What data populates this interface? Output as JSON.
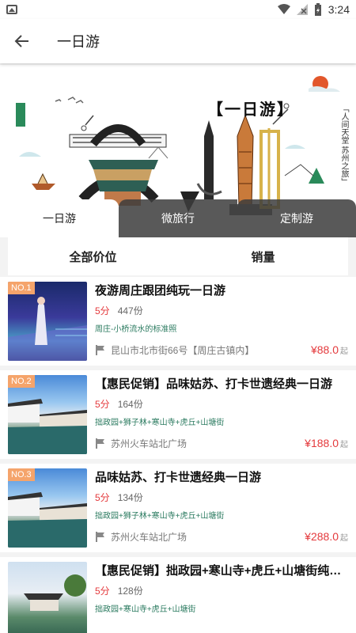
{
  "status": {
    "time": "3:24"
  },
  "header": {
    "title": "一日游",
    "back_icon": "arrow-left-icon"
  },
  "banner": {
    "title": "【一日游】",
    "side_text": "「人间天堂 苏州之旅」"
  },
  "tabs": [
    {
      "label": "一日游",
      "active": true
    },
    {
      "label": "微旅行",
      "active": false
    },
    {
      "label": "定制游",
      "active": false
    }
  ],
  "sort": {
    "all_price": "全部价位",
    "sales": "销量"
  },
  "items": [
    {
      "badge": "NO.1",
      "title": "夜游周庄跟团纯玩一日游",
      "score": "5分",
      "sold": "447份",
      "tags": "周庄-小桥流水的标准照",
      "location": "昆山市北市街66号【周庄古镇内】",
      "price": "¥88.0",
      "unit": "起"
    },
    {
      "badge": "NO.2",
      "title": "【惠民促销】品味姑苏、打卡世遗经典一日游",
      "score": "5分",
      "sold": "164份",
      "tags": "拙政园+狮子林+寒山寺+虎丘+山塘街",
      "location": "苏州火车站北广场",
      "price": "¥188.0",
      "unit": "起"
    },
    {
      "badge": "NO.3",
      "title": "品味姑苏、打卡世遗经典一日游",
      "score": "5分",
      "sold": "134份",
      "tags": "拙政园+狮子林+寒山寺+虎丘+山塘街",
      "location": "苏州火车站北广场",
      "price": "¥288.0",
      "unit": "起"
    },
    {
      "badge": "",
      "title": "【惠民促销】拙政园+寒山寺+虎丘+山塘街纯玩一...",
      "score": "5分",
      "sold": "128份",
      "tags": "拙政园+寒山寺+虎丘+山塘街",
      "location": "",
      "price": "",
      "unit": ""
    }
  ],
  "colors": {
    "price": "#e4393c",
    "badge": "#f5a46b",
    "tag": "#2a7a5f"
  }
}
